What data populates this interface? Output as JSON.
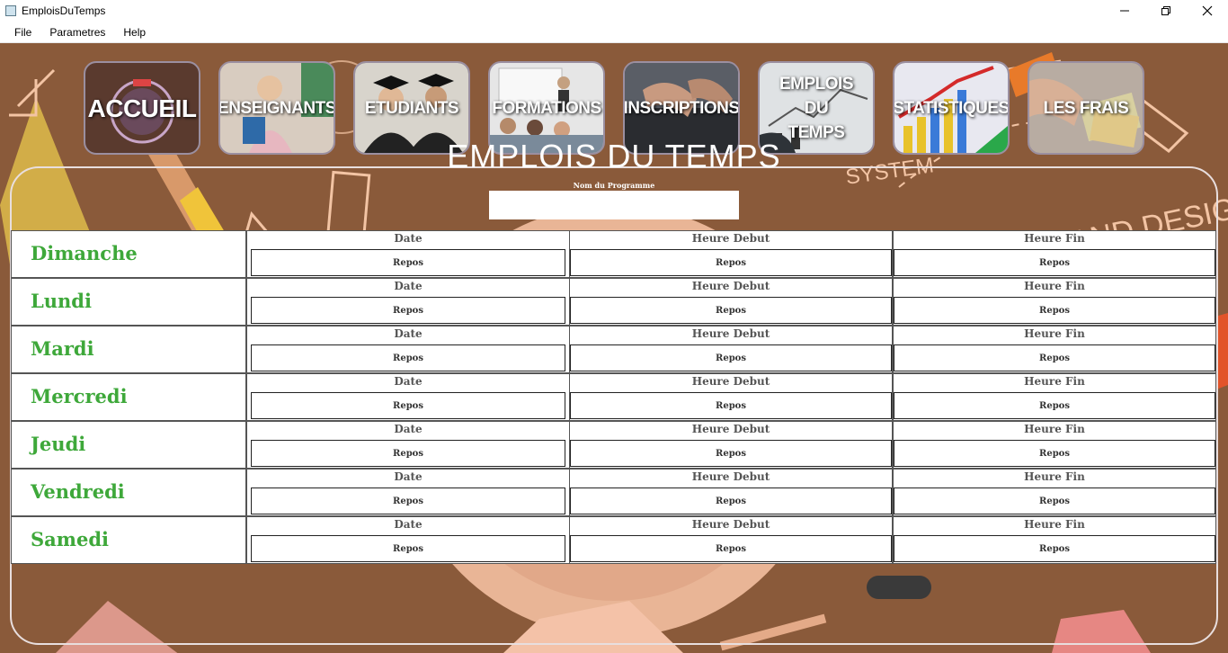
{
  "window": {
    "title": "EmploisDuTemps"
  },
  "menu": [
    "File",
    "Parametres",
    "Help"
  ],
  "nav": [
    {
      "label": "ACCUEIL",
      "icon": "school-logo-icon",
      "bg": "#5a3a2e"
    },
    {
      "label": "ENSEIGNANTS",
      "icon": "teacher-photo-icon",
      "bg": "#b7a79a"
    },
    {
      "label": "ETUDIANTS",
      "icon": "graduates-photo-icon",
      "bg": "#3a3632"
    },
    {
      "label": "FORMATIONS",
      "icon": "classroom-photo-icon",
      "bg": "#9aa0a6"
    },
    {
      "label": "INSCRIPTIONS",
      "icon": "keyboard-photo-icon",
      "bg": "#3d4048"
    },
    {
      "label": "EMPLOIS\nDU\nTEMPS",
      "icon": "chart-board-icon",
      "bg": "#6d737a"
    },
    {
      "label": "STATISTIQUES",
      "icon": "bar-chart-icon",
      "bg": "#3a2f3a"
    },
    {
      "label": "LES FRAIS",
      "icon": "money-photo-icon",
      "bg": "#8a7c72"
    }
  ],
  "page_title": "EMPLOIS DU TEMPS",
  "program": {
    "label": "Nom du Programme",
    "value": ""
  },
  "columns": {
    "date": "Date",
    "start": "Heure Debut",
    "end": "Heure Fin"
  },
  "days": [
    {
      "name": "Dimanche",
      "date": "Repos",
      "start": "Repos",
      "end": "Repos"
    },
    {
      "name": "Lundi",
      "date": "Repos",
      "start": "Repos",
      "end": "Repos"
    },
    {
      "name": "Mardi",
      "date": "Repos",
      "start": "Repos",
      "end": "Repos"
    },
    {
      "name": "Mercredi",
      "date": "Repos",
      "start": "Repos",
      "end": "Repos"
    },
    {
      "name": "Jeudi",
      "date": "Repos",
      "start": "Repos",
      "end": "Repos"
    },
    {
      "name": "Vendredi",
      "date": "Repos",
      "start": "Repos",
      "end": "Repos"
    },
    {
      "name": "Samedi",
      "date": "Repos",
      "start": "Repos",
      "end": "Repos"
    }
  ],
  "background": {
    "doodle_text": "ART AND DESIGN",
    "system_text": "SYSTEM"
  },
  "colors": {
    "day_name": "#3ea83a",
    "panel_border": "#e8dede",
    "bg": "#8a5a3a"
  }
}
